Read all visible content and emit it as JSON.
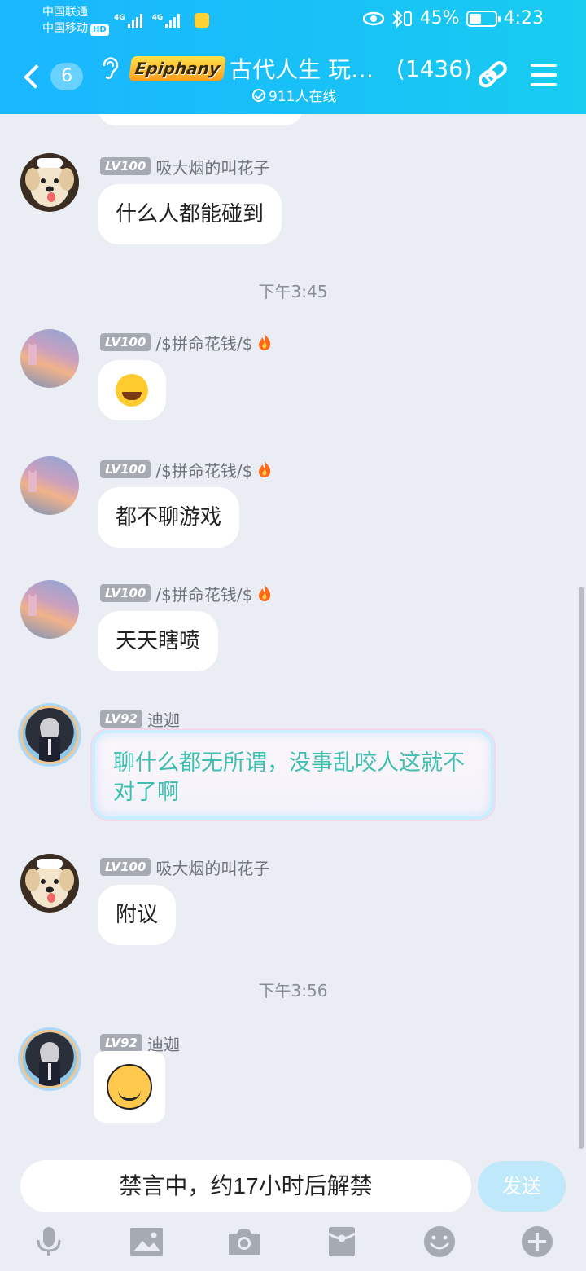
{
  "status_bar": {
    "carrier_1": "中国联通",
    "carrier_2": "中国移动",
    "hd": "HD",
    "net_1": "4G",
    "net_2": "4G",
    "battery": "45%",
    "battery_level": 0.45,
    "time": "4:23"
  },
  "header": {
    "unread_count": "6",
    "logo_text": "Epiphany",
    "group_name": "古代人生 玩家...",
    "member_count": "(1436)",
    "online": "911人在线"
  },
  "messages": [
    {
      "type": "text",
      "level": "LV100",
      "sender": "吸大烟的叫花子",
      "avatar": "dog-avatar",
      "text": "什么人都能碰到"
    },
    {
      "type": "time",
      "text": "下午3:45"
    },
    {
      "type": "emoji",
      "level": "LV100",
      "sender": "/$拼命花钱/$",
      "avatar": "sunset-avatar",
      "emoji": "😂",
      "badge": "fire-icon"
    },
    {
      "type": "text",
      "level": "LV100",
      "sender": "/$拼命花钱/$",
      "avatar": "sunset-avatar",
      "text": "都不聊游戏",
      "badge": "fire-icon"
    },
    {
      "type": "text",
      "level": "LV100",
      "sender": "/$拼命花钱/$",
      "avatar": "sunset-avatar",
      "text": "天天瞎喷",
      "badge": "fire-icon"
    },
    {
      "type": "special",
      "level": "LV92",
      "sender": "迪迦",
      "avatar": "anime-avatar",
      "text": "聊什么都无所谓，没事乱咬人这就不对了啊"
    },
    {
      "type": "text",
      "level": "LV100",
      "sender": "吸大烟的叫花子",
      "avatar": "dog-avatar",
      "text": "附议"
    },
    {
      "type": "time",
      "text": "下午3:56"
    },
    {
      "type": "sticker",
      "level": "LV92",
      "sender": "迪迦",
      "avatar": "anime-avatar",
      "sticker": "waving-smiley-sticker"
    }
  ],
  "input": {
    "muted_text": "禁言中，约17小时后解禁",
    "send_label": "发送"
  },
  "toolbar_icons": [
    "microphone-icon",
    "image-icon",
    "camera-icon",
    "red-packet-icon",
    "emoji-icon",
    "plus-icon"
  ],
  "colors": {
    "header_gradient_start": "#1ab6ff",
    "header_gradient_end": "#17cdf0",
    "special_text": "#3fbfb0",
    "send_button": "#bfe8fb",
    "background": "#eaedf3"
  }
}
